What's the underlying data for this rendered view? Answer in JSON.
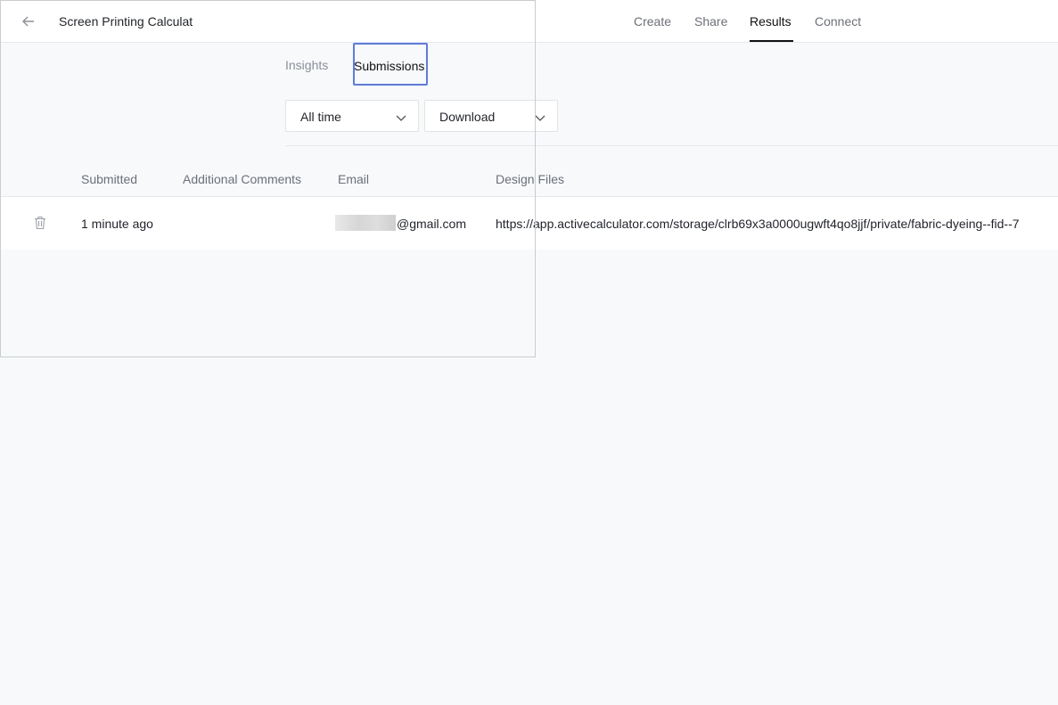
{
  "header": {
    "back_icon": "arrow-left-icon",
    "title": "Screen Printing Calculat",
    "tabs": [
      {
        "label": "Create"
      },
      {
        "label": "Share"
      },
      {
        "label": "Results"
      },
      {
        "label": "Connect"
      }
    ],
    "active_tab": "Results"
  },
  "subtabs": [
    {
      "label": "Insights"
    },
    {
      "label": "Submissions"
    }
  ],
  "active_subtab": "Submissions",
  "filters": {
    "range": {
      "value": "All time",
      "icon": "chevron-down-icon"
    },
    "download": {
      "value": "Download",
      "icon": "chevron-down-icon"
    }
  },
  "table": {
    "columns": [
      "Submitted",
      "Additional Comments",
      "Email",
      "Design Files"
    ],
    "rows": [
      {
        "delete_icon": "trash-icon",
        "submitted": "1 minute ago",
        "additional_comments": "",
        "email": "@gmail.com",
        "design_files": "https://app.activecalculator.com/storage/clrb69x3a0000ugwft4qo8jjf/private/fabric-dyeing--fid--7"
      }
    ]
  },
  "colors": {
    "focus_outline": "#5b7cf0",
    "background": "#f8f9fb",
    "active_underline": "#111111"
  }
}
